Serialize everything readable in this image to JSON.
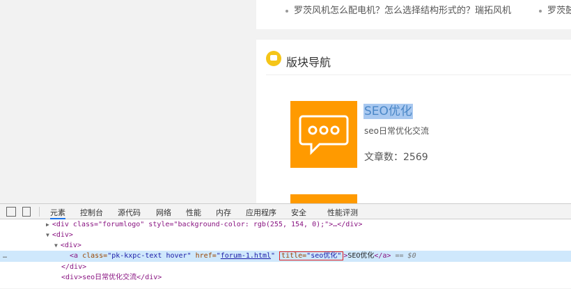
{
  "page": {
    "top_links": [
      "罗茨风机怎么配电机？怎么选择结构形式的？瑞拓风机",
      "罗茨鼓"
    ],
    "section_title": "版块导航",
    "forum": {
      "title": "SEO优化",
      "description": "seo日常优化交流",
      "count_label": "文章数：",
      "count": "2569"
    },
    "colors": {
      "logo_bg": "#ff9a00",
      "section_icon": "#f5c518",
      "highlight": "#a8c8f0"
    }
  },
  "devtools": {
    "tabs": [
      "元素",
      "控制台",
      "源代码",
      "网络",
      "性能",
      "内存",
      "应用程序",
      "安全",
      "性能评测"
    ],
    "active_tab": "元素",
    "lines": {
      "l0": "<div class=\"forumlogo\" style=\"background-color: rgb(255, 154, 0);\">…</div>",
      "l1": "<div>",
      "l2": "<div>",
      "l3a_tag": "<a ",
      "l3a_attr1": "class=",
      "l3a_val1": "\"pk-kxpc-text hover\"",
      "l3a_attr2": " href=",
      "l3a_val2_q1": "\"",
      "l3a_val2_link": "forum-1.html",
      "l3a_val2_q2": "\"",
      "l3a_attr3": "title=",
      "l3a_val3": "\"seo优化\"",
      "l3a_close": ">",
      "l3a_text": "SEO优化",
      "l3a_end": "</a>",
      "l3a_dollar": " == $0",
      "l4": "</div>",
      "l5": "<div>seo日常优化交流</div>",
      "ellipsis": "…"
    }
  }
}
